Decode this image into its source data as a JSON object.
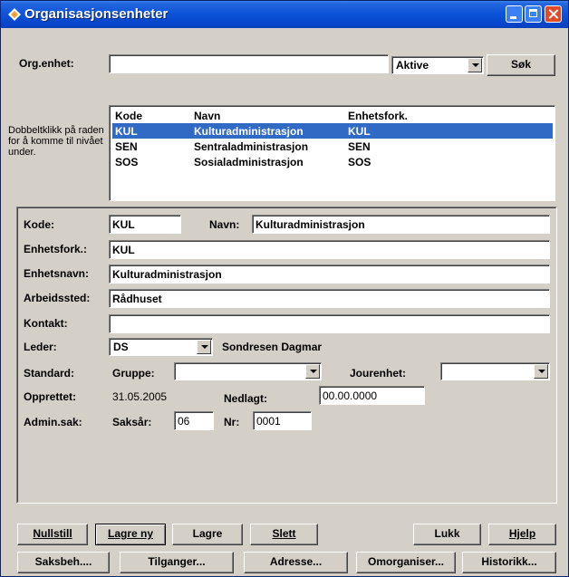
{
  "window": {
    "title": "Organisasjonsenheter"
  },
  "search": {
    "org_label": "Org.enhet:",
    "org_value": "",
    "filter_value": "Aktive",
    "search_button": "Søk"
  },
  "list": {
    "help_text": "Dobbeltklikk på raden for å komme til nivået under.",
    "headers": [
      "Kode",
      "Navn",
      "Enhetsfork."
    ],
    "rows": [
      {
        "kode": "KUL",
        "navn": "Kulturadministrasjon",
        "fork": "KUL"
      },
      {
        "kode": "SEN",
        "navn": "Sentraladministrasjon",
        "fork": "SEN"
      },
      {
        "kode": "SOS",
        "navn": "Sosialadministrasjon",
        "fork": "SOS"
      }
    ]
  },
  "detail": {
    "kode_label": "Kode:",
    "kode_value": "KUL",
    "navn_label": "Navn:",
    "navn_value": "Kulturadministrasjon",
    "enhetsfork_label": "Enhetsfork.:",
    "enhetsfork_value": "KUL",
    "enhetsnavn_label": "Enhetsnavn:",
    "enhetsnavn_value": "Kulturadministrasjon",
    "arbeidssted_label": "Arbeidssted:",
    "arbeidssted_value": "Rådhuset",
    "kontakt_label": "Kontakt:",
    "kontakt_value": "",
    "leder_label": "Leder:",
    "leder_value": "DS",
    "leder_name": "Sondresen Dagmar",
    "standard_label": "Standard:",
    "gruppe_label": "Gruppe:",
    "gruppe_value": "",
    "jourenhet_label": "Jourenhet:",
    "jourenhet_value": "",
    "opprettet_label": "Opprettet:",
    "opprettet_value": "31.05.2005",
    "nedlagt_label": "Nedlagt:",
    "nedlagt_value": "00.00.0000",
    "adminsak_label": "Admin.sak:",
    "saksar_label": "Saksår:",
    "saksar_value": "06",
    "nr_label": "Nr:",
    "nr_value": "0001"
  },
  "buttons": {
    "nullstill": "Nullstill",
    "lagre_ny": "Lagre ny",
    "lagre": "Lagre",
    "slett": "Slett",
    "lukk": "Lukk",
    "hjelp": "Hjelp",
    "saksbeh": "Saksbeh....",
    "tilganger": "Tilganger...",
    "adresse": "Adresse...",
    "omorganiser": "Omorganiser...",
    "historikk": "Historikk..."
  },
  "colors": {
    "title_bar": "#0a53d9",
    "selection": "#316ac5",
    "face": "#d4d0c8"
  }
}
